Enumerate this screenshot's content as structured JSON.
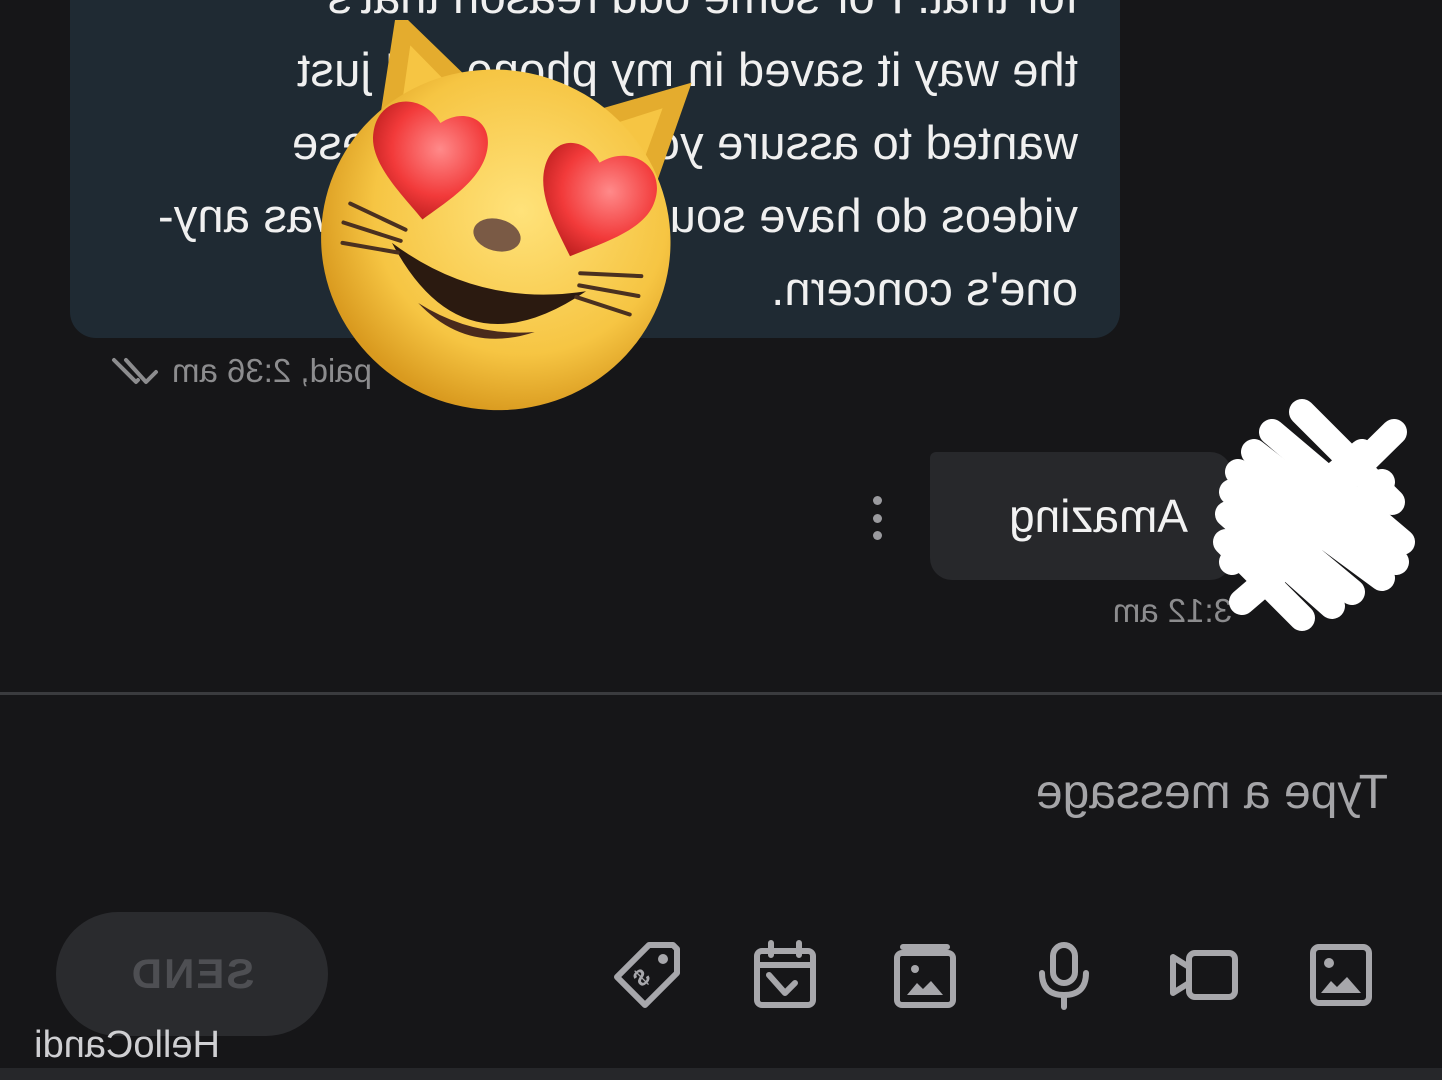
{
  "conversation": {
    "incoming_message": {
      "lines": [
        "for that. For some odd reason that's",
        "the way it saved in my phone. :( I just",
        "wanted to assure you that all of these",
        "videos do have sound in case that was any-",
        "one's concern."
      ],
      "meta": "paid, 2:36 am",
      "status_icon": "double-check-icon"
    },
    "outgoing_message": {
      "text": "Amazing",
      "time": "3:12 am",
      "menu_icon": "more-vertical-icon"
    },
    "sticker": {
      "emoji": "smiling-cat-with-heart-eyes"
    }
  },
  "composer": {
    "placeholder": "Type a message",
    "send_label": "SEND",
    "tools": [
      {
        "name": "image-icon"
      },
      {
        "name": "video-icon"
      },
      {
        "name": "microphone-icon"
      },
      {
        "name": "vault-icon"
      },
      {
        "name": "schedule-icon"
      },
      {
        "name": "price-tag-icon"
      }
    ]
  },
  "watermark": "HelloCandi",
  "colors": {
    "background": "#161618",
    "incoming_bubble": "#1f2a33",
    "outgoing_bubble": "#27282b",
    "muted_text": "#8c8c8e",
    "icon": "#a7a7ab",
    "send_disabled_text": "#4e4f53"
  }
}
